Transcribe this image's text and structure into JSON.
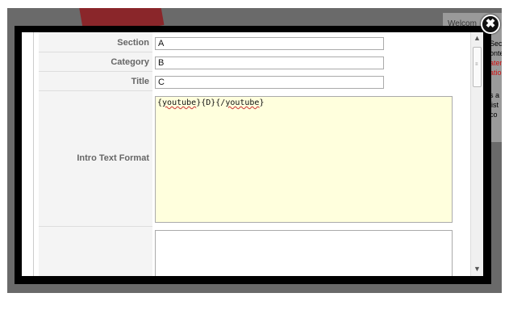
{
  "background": {
    "welcome_text": "Welcom",
    "fragments": [
      {
        "text": "Sec",
        "color": "#222222"
      },
      {
        "text": "onte",
        "color": "#222222"
      },
      {
        "text": "ater",
        "color": "#cc1111"
      },
      {
        "text": "ation",
        "color": "#cc1111"
      },
      {
        "text": "s a",
        "color": "#222222"
      },
      {
        "text": "list",
        "color": "#222222"
      },
      {
        "text": "co",
        "color": "#222222"
      }
    ]
  },
  "modal": {
    "close_glyph": "✖",
    "form": {
      "section": {
        "label": "Section",
        "value": "A"
      },
      "category": {
        "label": "Category",
        "value": "B"
      },
      "title": {
        "label": "Title",
        "value": "C"
      },
      "intro_text_format": {
        "label": "Intro Text Format",
        "parts": [
          "{",
          "youtube",
          "}{D}{/",
          "youtube",
          "}"
        ]
      }
    },
    "scrollbar": {
      "up": "▲",
      "down": "▼",
      "grip": "≡"
    }
  },
  "colors": {
    "overlay": "#6a6a6a",
    "modal_frame": "#000000",
    "editor_background": "#ffffdd"
  }
}
